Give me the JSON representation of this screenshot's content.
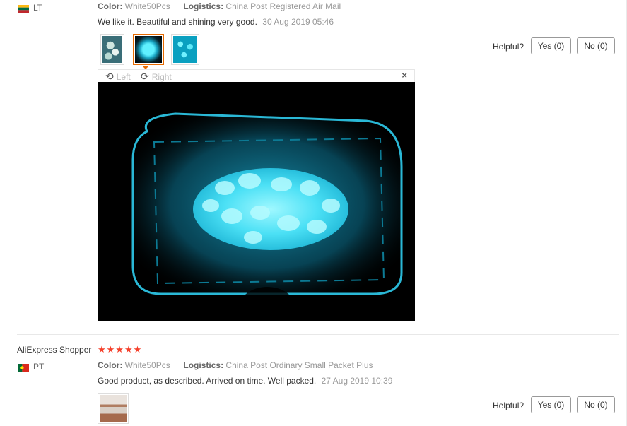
{
  "review1": {
    "country": "LT",
    "color_label": "Color:",
    "color_value": "White50Pcs",
    "logistics_label": "Logistics:",
    "logistics_value": "China Post Registered Air Mail",
    "text": "We like it. Beautiful and shining very good.",
    "date": "30 Aug 2019 05:46",
    "helpful_label": "Helpful?",
    "yes_label": "Yes (0)",
    "no_label": "No (0)"
  },
  "viewer": {
    "rotate_left": "Left",
    "rotate_right": "Right",
    "close": "×"
  },
  "review2": {
    "reviewer": "AliExpress Shopper",
    "stars": "★★★★★",
    "country": "PT",
    "color_label": "Color:",
    "color_value": "White50Pcs",
    "logistics_label": "Logistics:",
    "logistics_value": "China Post Ordinary Small Packet Plus",
    "text": "Good product, as described. Arrived on time. Well packed.",
    "date": "27 Aug 2019 10:39",
    "helpful_label": "Helpful?",
    "yes_label": "Yes (0)",
    "no_label": "No (0)"
  },
  "colors": {
    "star": "#f5402b",
    "active_thumb": "#e66a00",
    "glow": "#2fd2f0"
  }
}
